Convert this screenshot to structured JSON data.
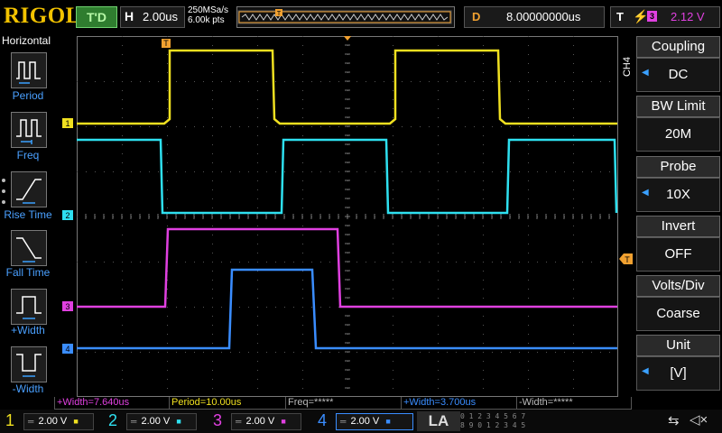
{
  "brand": "RIGOL",
  "trigger_status": "T'D",
  "horizontal": {
    "label": "H",
    "timebase": "2.00us",
    "sample_rate": "250MSa/s",
    "memory_depth": "6.00k pts"
  },
  "delay": {
    "label": "D",
    "value": "8.00000000us"
  },
  "trigger": {
    "label": "T",
    "source": "3",
    "level": "2.12 V"
  },
  "left_menu": {
    "title": "Horizontal",
    "items": [
      {
        "label": "Period",
        "icon": "period-icon"
      },
      {
        "label": "Freq",
        "icon": "freq-icon"
      },
      {
        "label": "Rise Time",
        "icon": "rise-time-icon"
      },
      {
        "label": "Fall Time",
        "icon": "fall-time-icon"
      },
      {
        "label": "+Width",
        "icon": "pos-width-icon"
      },
      {
        "label": "-Width",
        "icon": "neg-width-icon"
      }
    ]
  },
  "right_menu": {
    "channel": "CH4",
    "items": [
      {
        "title": "Coupling",
        "value": "DC"
      },
      {
        "title": "BW Limit",
        "value": "20M"
      },
      {
        "title": "Probe",
        "value": "10X"
      },
      {
        "title": "Invert",
        "value": "OFF"
      },
      {
        "title": "Volts/Div",
        "value": "Coarse"
      },
      {
        "title": "Unit",
        "value": "[V]"
      }
    ]
  },
  "measurements": [
    {
      "text": "+Width=7.640us",
      "color": "#e040e0"
    },
    {
      "text": "Period=10.00us",
      "color": "#f0e020"
    },
    {
      "text": "Freq=*****",
      "color": "#bbbbbb"
    },
    {
      "text": "+Width=3.700us",
      "color": "#3a8dff"
    },
    {
      "text": "-Width=*****",
      "color": "#bbbbbb"
    }
  ],
  "channels": [
    {
      "num": "1",
      "scale": "2.00 V",
      "color": "#f0e020"
    },
    {
      "num": "2",
      "scale": "2.00 V",
      "color": "#2ee0f0"
    },
    {
      "num": "3",
      "scale": "2.00 V",
      "color": "#e040e0"
    },
    {
      "num": "4",
      "scale": "2.00 V",
      "color": "#3a8dff"
    }
  ],
  "la_label": "LA",
  "la_digits": {
    "row1": "0 1 2 3  4 5 6 7",
    "row2": "8 9 0 1  2 3 4 5"
  },
  "colors": {
    "ch1": "#f0e020",
    "ch2": "#2ee0f0",
    "ch3": "#e040e0",
    "ch4": "#3a8dff",
    "grid": "#555555",
    "menu_accent": "#3aa0ff"
  },
  "icons": {
    "trigger_edge": "rising-edge-icon",
    "usb": "usb-icon",
    "speaker": "speaker-mute-icon"
  }
}
